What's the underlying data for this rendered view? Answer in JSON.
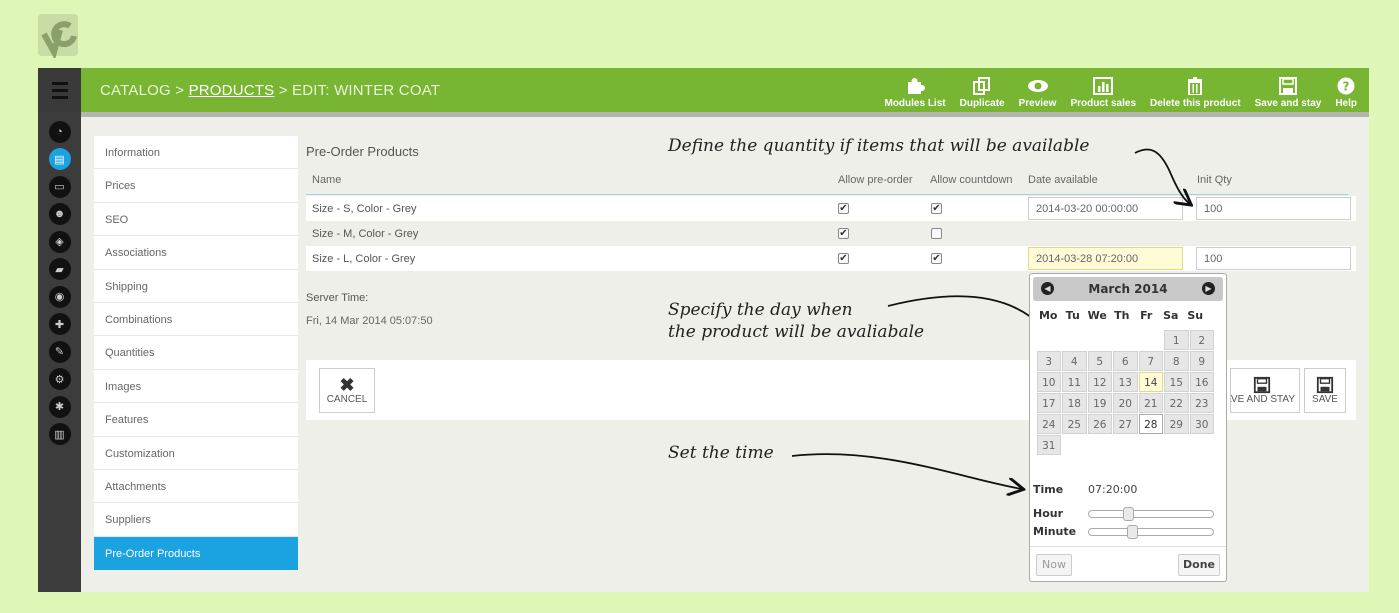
{
  "breadcrumb": {
    "part1": "CATALOG > ",
    "part2": "PRODUCTS",
    "part3": " > EDIT: WINTER COAT"
  },
  "toolbar": [
    {
      "label": "Modules List",
      "icon": "puzzle-icon"
    },
    {
      "label": "Duplicate",
      "icon": "duplicate-icon"
    },
    {
      "label": "Preview",
      "icon": "eye-icon"
    },
    {
      "label": "Product sales",
      "icon": "chart-icon"
    },
    {
      "label": "Delete this product",
      "icon": "trash-icon"
    },
    {
      "label": "Save and stay",
      "icon": "floppy-icon"
    },
    {
      "label": "Help",
      "icon": "help-icon"
    }
  ],
  "tabs": [
    "Information",
    "Prices",
    "SEO",
    "Associations",
    "Shipping",
    "Combinations",
    "Quantities",
    "Images",
    "Features",
    "Customization",
    "Attachments",
    "Suppliers",
    "Pre-Order Products"
  ],
  "active_tab": "Pre-Order Products",
  "section_title": "Pre-Order Products",
  "table": {
    "headers": {
      "name": "Name",
      "allow_preorder": "Allow pre-order",
      "allow_countdown": "Allow countdown",
      "date_available": "Date available",
      "init_qty": "Init Qty"
    },
    "rows": [
      {
        "name": "Size - S, Color - Grey",
        "preorder": true,
        "countdown": true,
        "date": "2014-03-20 00:00:00",
        "qty": "100"
      },
      {
        "name": "Size - M, Color - Grey",
        "preorder": true,
        "countdown": false,
        "date": "",
        "qty": ""
      },
      {
        "name": "Size - L, Color - Grey",
        "preorder": true,
        "countdown": true,
        "date": "2014-03-28 07:20:00",
        "qty": "100"
      }
    ]
  },
  "server_time": {
    "label": "Server Time:",
    "value": "Fri, 14 Mar 2014 05:07:50"
  },
  "buttons": {
    "cancel": "CANCEL",
    "save_and_stay": "SAVE AND STAY",
    "save": "SAVE"
  },
  "annotations": {
    "quantity": "Define the quantity if items that will be available",
    "day_line1": "Specify the day when",
    "day_line2": "the product will be avaliabale",
    "time": "Set the time"
  },
  "datepicker": {
    "month": "March 2014",
    "weekdays": [
      "Mo",
      "Tu",
      "We",
      "Th",
      "Fr",
      "Sa",
      "Su"
    ],
    "weeks": [
      [
        "",
        "",
        "",
        "",
        "",
        "1",
        "2"
      ],
      [
        "3",
        "4",
        "5",
        "6",
        "7",
        "8",
        "9"
      ],
      [
        "10",
        "11",
        "12",
        "13",
        "14",
        "15",
        "16"
      ],
      [
        "17",
        "18",
        "19",
        "20",
        "21",
        "22",
        "23"
      ],
      [
        "24",
        "25",
        "26",
        "27",
        "28",
        "29",
        "30"
      ],
      [
        "31",
        "",
        "",
        "",
        "",
        "",
        ""
      ]
    ],
    "today": "14",
    "selected": "28",
    "time_label": "Time",
    "time_value": "07:20:00",
    "hour_label": "Hour",
    "minute_label": "Minute",
    "hour_fraction": 0.3,
    "minute_fraction": 0.33,
    "now_label": "Now",
    "done_label": "Done"
  },
  "colors": {
    "topbar": "#78b532",
    "accent": "#1aa3e0",
    "background": "#dff7b6"
  }
}
